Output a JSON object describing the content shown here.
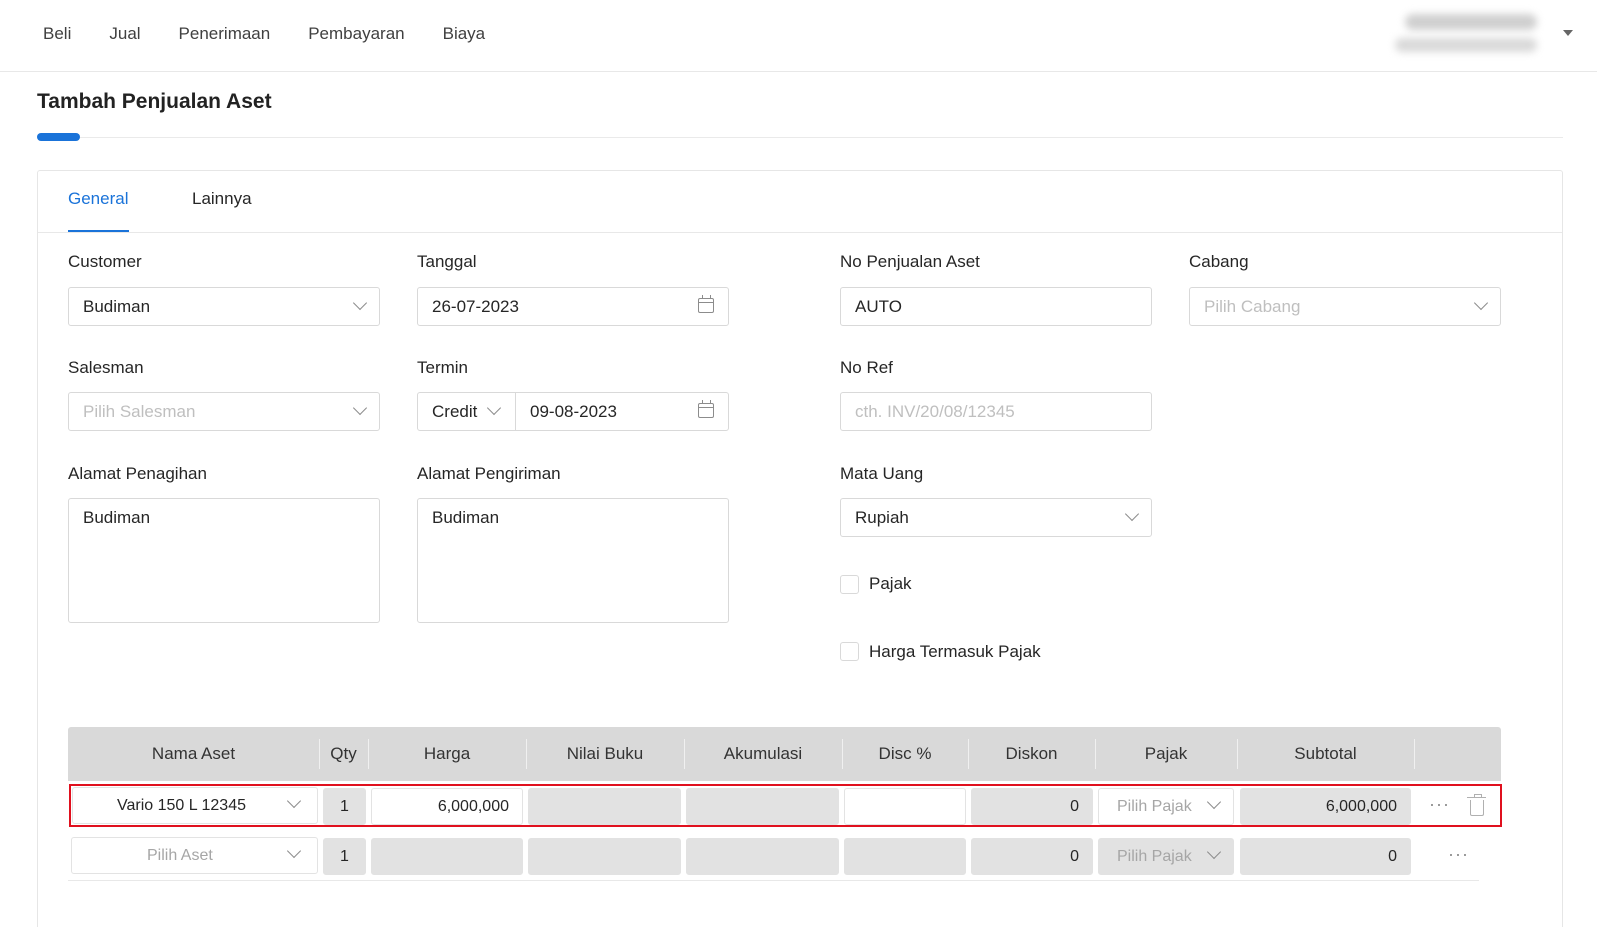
{
  "nav": {
    "items": [
      "Beli",
      "Jual",
      "Penerimaan",
      "Pembayaran",
      "Biaya"
    ]
  },
  "page": {
    "title": "Tambah Penjualan Aset"
  },
  "tabs": {
    "general": "General",
    "lainnya": "Lainnya"
  },
  "form": {
    "customer": {
      "label": "Customer",
      "value": "Budiman"
    },
    "tanggal": {
      "label": "Tanggal",
      "value": "26-07-2023"
    },
    "no_penjualan": {
      "label": "No Penjualan Aset",
      "value": "AUTO"
    },
    "cabang": {
      "label": "Cabang",
      "placeholder": "Pilih Cabang"
    },
    "salesman": {
      "label": "Salesman",
      "placeholder": "Pilih Salesman"
    },
    "termin": {
      "label": "Termin",
      "type": "Credit",
      "date": "09-08-2023"
    },
    "no_ref": {
      "label": "No Ref",
      "placeholder": "cth. INV/20/08/12345"
    },
    "alamat_penagihan": {
      "label": "Alamat Penagihan",
      "value": "Budiman"
    },
    "alamat_pengiriman": {
      "label": "Alamat Pengiriman",
      "value": "Budiman"
    },
    "mata_uang": {
      "label": "Mata Uang",
      "value": "Rupiah"
    },
    "pajak": {
      "label": "Pajak",
      "checked": false
    },
    "harga_termasuk_pajak": {
      "label": "Harga Termasuk Pajak",
      "checked": false
    }
  },
  "table": {
    "headers": [
      "Nama Aset",
      "Qty",
      "Harga",
      "Nilai Buku",
      "Akumulasi",
      "Disc %",
      "Diskon",
      "Pajak",
      "Subtotal"
    ],
    "rows": [
      {
        "nama": "Vario 150 L 12345",
        "qty": "1",
        "harga": "6,000,000",
        "nilai_buku": "",
        "akumulasi": "",
        "disc_pct": "",
        "diskon": "0",
        "pajak": "Pilih Pajak",
        "subtotal": "6,000,000"
      },
      {
        "nama": "Pilih Aset",
        "qty": "1",
        "harga": "",
        "nilai_buku": "",
        "akumulasi": "",
        "disc_pct": "",
        "diskon": "0",
        "pajak": "Pilih Pajak",
        "subtotal": "0"
      }
    ]
  },
  "colors": {
    "accent": "#1a73d9",
    "highlight": "#e0101e"
  }
}
